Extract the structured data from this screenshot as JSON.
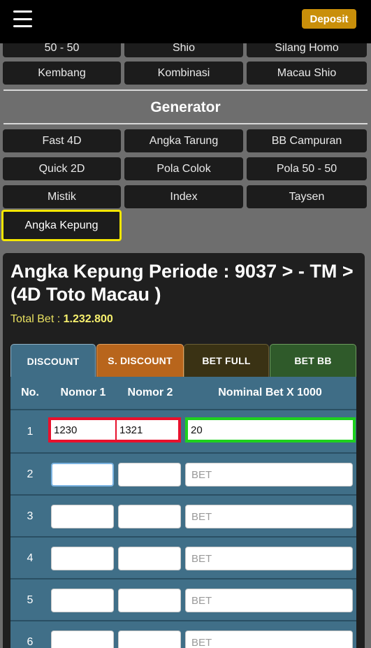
{
  "header": {
    "deposit_label": "Deposit"
  },
  "menu": {
    "partial_row": [
      "50 - 50",
      "Shio",
      "Silang Homo"
    ],
    "row1": [
      "Kembang",
      "Kombinasi",
      "Macau Shio"
    ]
  },
  "generator": {
    "title": "Generator",
    "rows": [
      [
        "Fast 4D",
        "Angka Tarung",
        "BB Campuran"
      ],
      [
        "Quick 2D",
        "Pola Colok",
        "Pola 50 - 50"
      ],
      [
        "Mistik",
        "Index",
        "Taysen"
      ]
    ],
    "active_label": "Angka Kepung"
  },
  "panel": {
    "title": "Angka Kepung Periode : 9037 > - TM > (4D Toto Macau )",
    "total_bet_label": "Total Bet :",
    "total_bet_value": "1.232.800",
    "tabs": [
      "DISCOUNT",
      "S. DISCOUNT",
      "BET FULL",
      "BET BB"
    ],
    "columns": [
      "No.",
      "Nomor 1",
      "Nomor 2",
      "Nominal Bet X 1000"
    ],
    "bet_placeholder": "BET",
    "rows": [
      {
        "no": "1",
        "nomor1": "1230",
        "nomor2": "1321",
        "bet": "20"
      },
      {
        "no": "2",
        "nomor1": "",
        "nomor2": "",
        "bet": ""
      },
      {
        "no": "3",
        "nomor1": "",
        "nomor2": "",
        "bet": ""
      },
      {
        "no": "4",
        "nomor1": "",
        "nomor2": "",
        "bet": ""
      },
      {
        "no": "5",
        "nomor1": "",
        "nomor2": "",
        "bet": ""
      },
      {
        "no": "6",
        "nomor1": "",
        "nomor2": "",
        "bet": ""
      }
    ]
  },
  "colors": {
    "accent_gold": "#c98f0a",
    "highlight_yellow": "#f5e700",
    "tab_discount": "#3f6d86",
    "tab_s_discount": "#b8651c",
    "tab_bet_full": "#3a3214",
    "tab_bet_bb": "#2f5a2a"
  }
}
